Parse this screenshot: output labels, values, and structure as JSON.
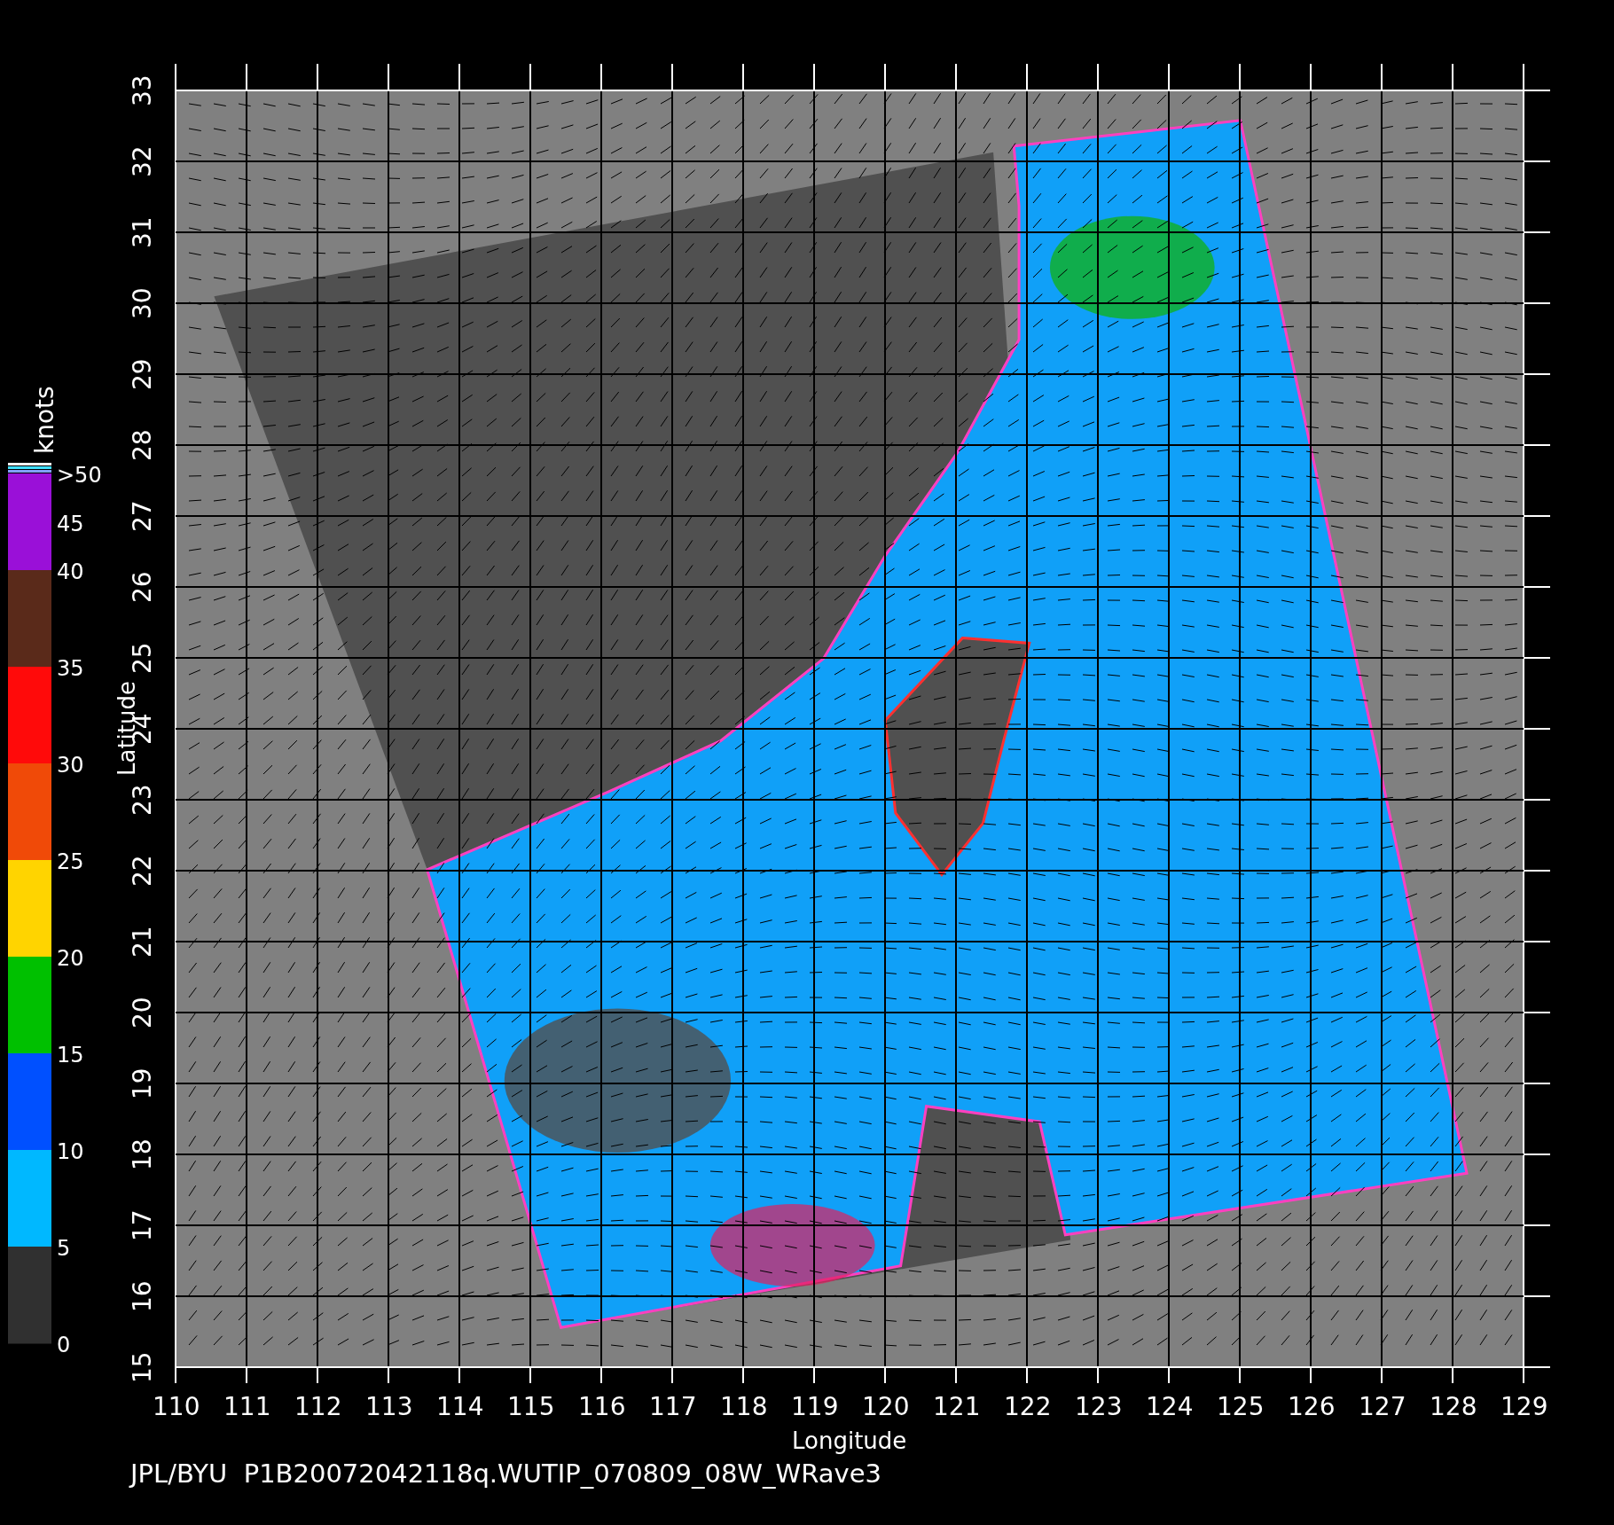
{
  "plot": {
    "xlabel": "Longitude",
    "ylabel": "Latitude",
    "xticks": [
      "110",
      "111",
      "112",
      "113",
      "114",
      "115",
      "116",
      "117",
      "118",
      "119",
      "120",
      "121",
      "122",
      "123",
      "124",
      "125",
      "126",
      "127",
      "128",
      "129"
    ],
    "yticks": [
      "15",
      "16",
      "17",
      "18",
      "19",
      "20",
      "21",
      "22",
      "23",
      "24",
      "25",
      "26",
      "27",
      "28",
      "29",
      "30",
      "31",
      "32",
      "33"
    ]
  },
  "colorbar": {
    "unit": "knots",
    "bands": [
      {
        "label": ">50",
        "color": "#9a10d8"
      },
      {
        "label": "40",
        "color": "#5a2a1a"
      },
      {
        "label": "35",
        "color": "#ff0a0a"
      },
      {
        "label": "30",
        "color": "#f04a08"
      },
      {
        "label": "25",
        "color": "#ffd400"
      },
      {
        "label": "20",
        "color": "#00c000"
      },
      {
        "label": "15",
        "color": "#0050ff"
      },
      {
        "label": "10",
        "color": "#00b8ff"
      },
      {
        "label": "5",
        "color": "#303030"
      }
    ],
    "bottom_label": "0",
    "extra_labels": [
      "45"
    ]
  },
  "footer": "JPL/BYU  P1B20072042118q.WUTIP_070809_08W_WRave3"
}
